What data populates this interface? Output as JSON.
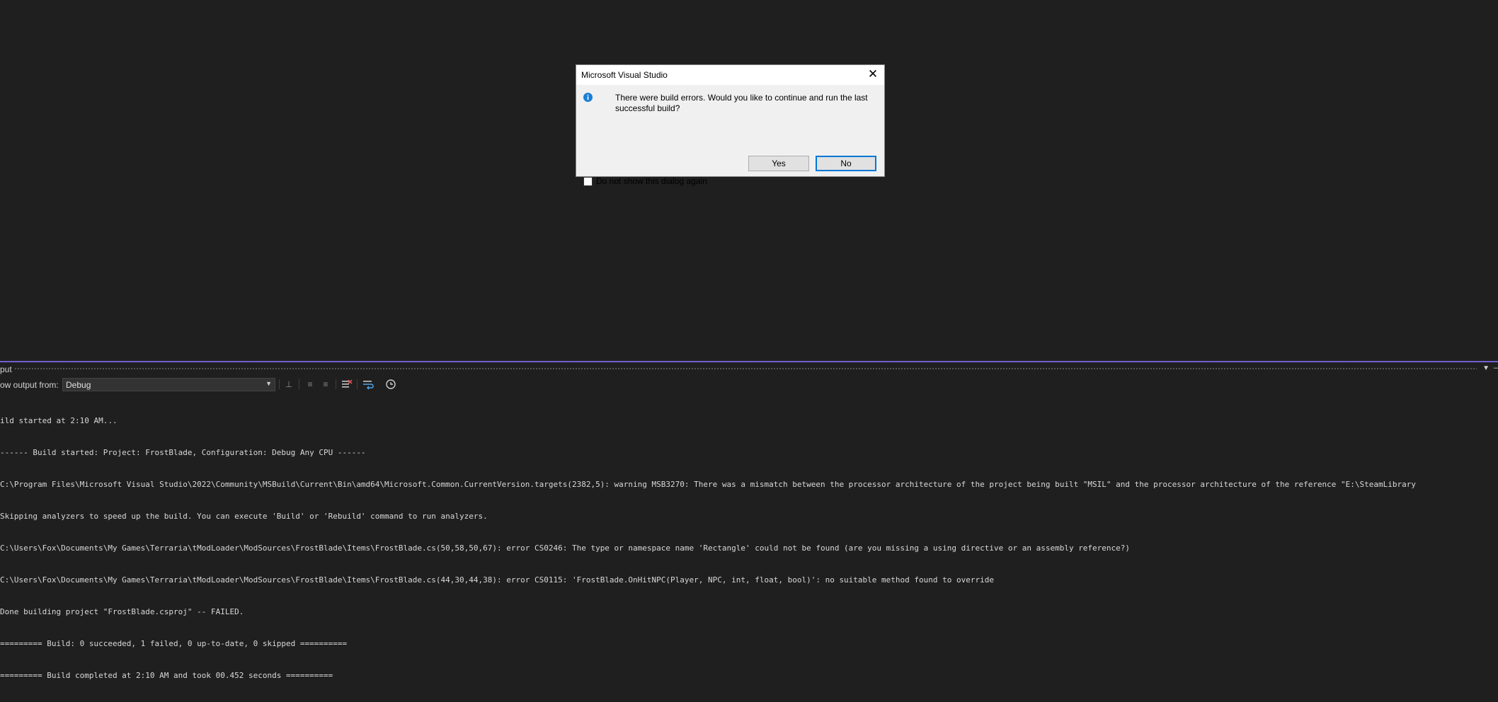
{
  "dialog": {
    "title": "Microsoft Visual Studio",
    "message": "There were build errors. Would you like to continue and run the last successful build?",
    "yes_label": "Yes",
    "no_label": "No",
    "checkbox_label": "Do not show this dialog again",
    "icon": "info-icon",
    "accent_color": "#0078d7"
  },
  "output_pane": {
    "title": "put",
    "show_output_label": "ow output from:",
    "source_selected": "Debug",
    "accent_color": "#6f5fd0",
    "lines": [
      "ild started at 2:10 AM...",
      "------ Build started: Project: FrostBlade, Configuration: Debug Any CPU ------",
      "C:\\Program Files\\Microsoft Visual Studio\\2022\\Community\\MSBuild\\Current\\Bin\\amd64\\Microsoft.Common.CurrentVersion.targets(2382,5): warning MSB3270: There was a mismatch between the processor architecture of the project being built \"MSIL\" and the processor architecture of the reference \"E:\\SteamLibrary",
      "Skipping analyzers to speed up the build. You can execute 'Build' or 'Rebuild' command to run analyzers.",
      "C:\\Users\\Fox\\Documents\\My Games\\Terraria\\tModLoader\\ModSources\\FrostBlade\\Items\\FrostBlade.cs(50,58,50,67): error CS0246: The type or namespace name 'Rectangle' could not be found (are you missing a using directive or an assembly reference?)",
      "C:\\Users\\Fox\\Documents\\My Games\\Terraria\\tModLoader\\ModSources\\FrostBlade\\Items\\FrostBlade.cs(44,30,44,38): error CS0115: 'FrostBlade.OnHitNPC(Player, NPC, int, float, bool)': no suitable method found to override",
      "Done building project \"FrostBlade.csproj\" -- FAILED.",
      "========= Build: 0 succeeded, 1 failed, 0 up-to-date, 0 skipped ==========",
      "========= Build completed at 2:10 AM and took 00.452 seconds =========="
    ]
  }
}
